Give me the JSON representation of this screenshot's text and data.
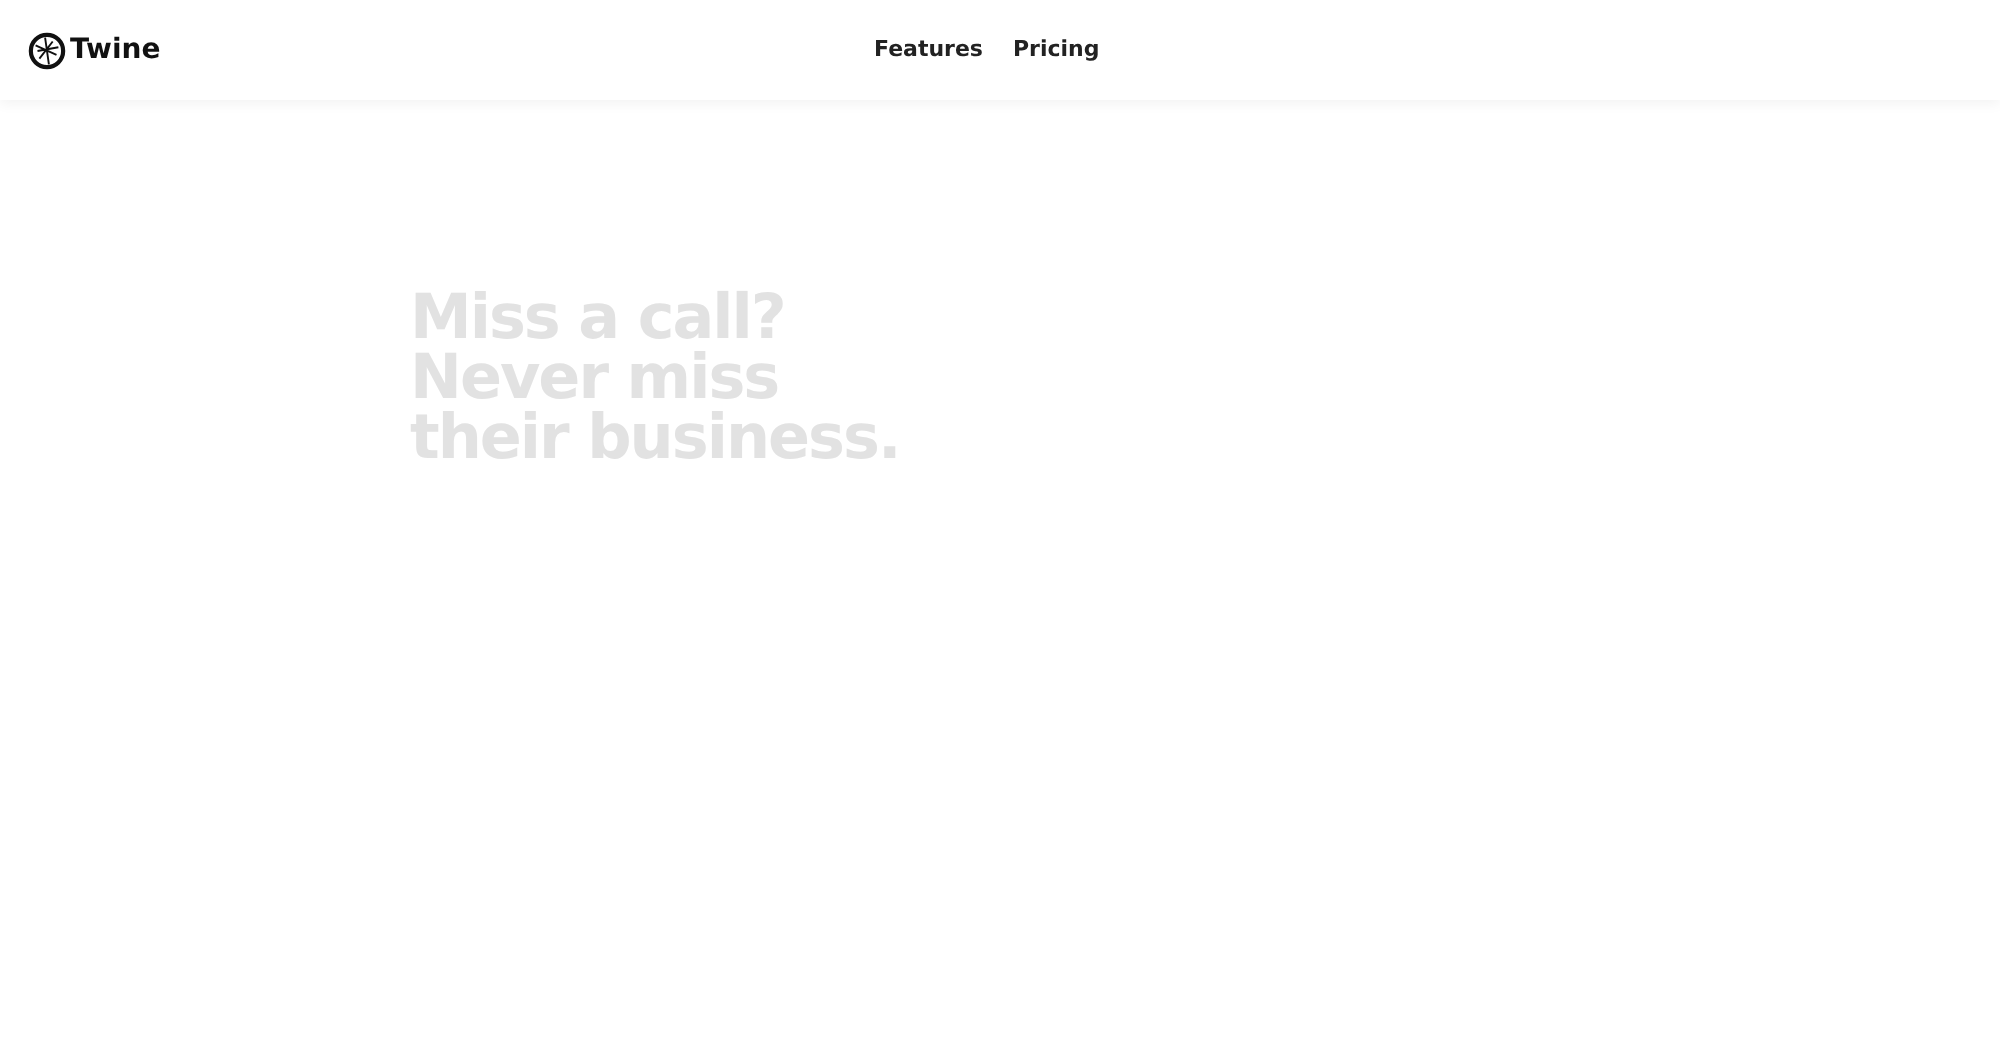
{
  "header": {
    "brand": "Twine",
    "nav": [
      {
        "label": "Features"
      },
      {
        "label": "Pricing"
      }
    ]
  },
  "hero": {
    "headline_lines": [
      "Miss a call?",
      "Never miss",
      "their business."
    ]
  }
}
